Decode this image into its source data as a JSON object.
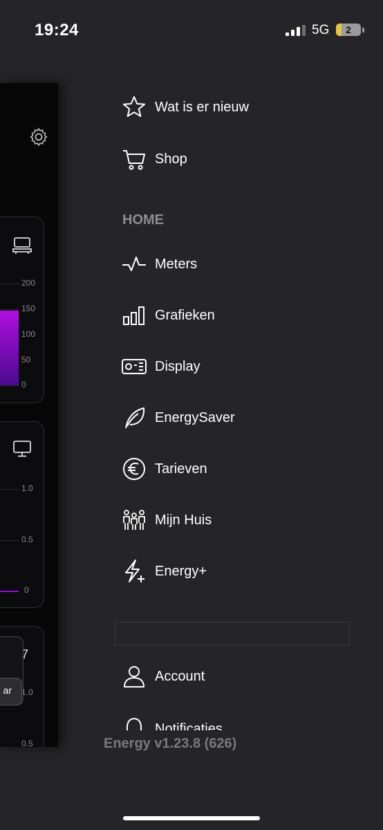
{
  "status": {
    "time": "19:24",
    "network": "5G",
    "battery": "2"
  },
  "app_panel": {
    "card1_ticks": [
      "200",
      "150",
      "100",
      "50",
      "0"
    ],
    "card2_ticks": [
      "1.0",
      "0.5",
      "0"
    ],
    "card3_ticks": [
      "1.0",
      "0.5"
    ],
    "card3_partial_label": "7",
    "popup_button_label": "ar",
    "accent": "#8a10d8"
  },
  "menu": {
    "items_top": [
      {
        "label": "Wat is er nieuw",
        "icon": "star-icon"
      },
      {
        "label": "Shop",
        "icon": "cart-icon"
      }
    ],
    "section_home": "HOME",
    "items_home": [
      {
        "label": "Meters",
        "icon": "pulse-icon"
      },
      {
        "label": "Grafieken",
        "icon": "bar-chart-icon"
      },
      {
        "label": "Display",
        "icon": "display-icon"
      },
      {
        "label": "EnergySaver",
        "icon": "leaf-icon"
      },
      {
        "label": "Tarieven",
        "icon": "euro-icon"
      },
      {
        "label": "Mijn Huis",
        "icon": "family-icon"
      },
      {
        "label": "Energy+",
        "icon": "bolt-plus-icon"
      }
    ],
    "items_bottom": [
      {
        "label": "Account",
        "icon": "person-icon"
      },
      {
        "label": "Notificaties",
        "icon": "bell-icon"
      }
    ]
  },
  "version": "Energy v1.23.8 (626)"
}
